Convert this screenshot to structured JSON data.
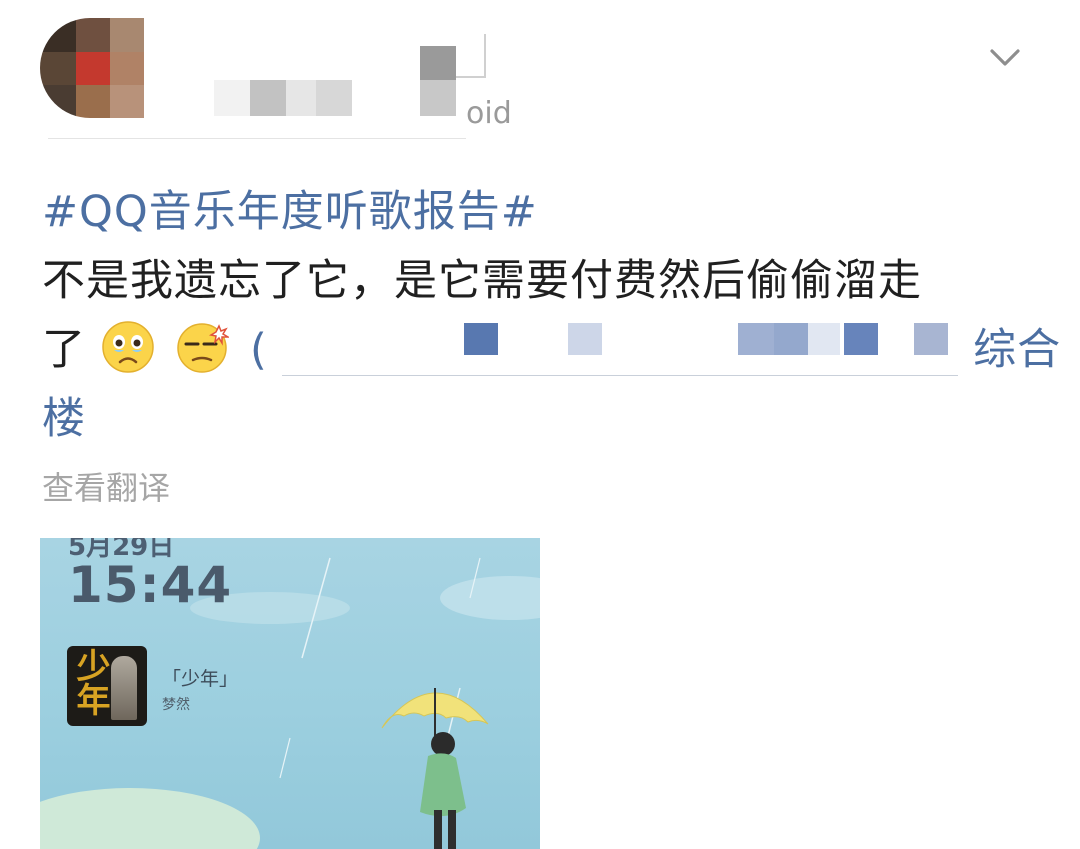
{
  "header": {
    "meta_suffix": "oid",
    "expand_icon": "chevron-down-icon"
  },
  "post": {
    "hashtag": "#QQ音乐年度听歌报告#",
    "text_line1": "不是我遗忘了它，是它需要付费然后偷偷溜走",
    "text_line2_start": "了",
    "emojis": [
      "crying-face-emoji",
      "annoyed-face-emoji"
    ],
    "mention_start": "(",
    "link_tail": "综合",
    "text_line3": "楼",
    "translate_label": "查看翻译"
  },
  "screenshot": {
    "date": "5月29日",
    "time": "15:44",
    "song_title": "「少年」",
    "artist": "梦然",
    "album_art_text": "少年"
  },
  "colors": {
    "hashtag": "#4c6fa2",
    "body_text": "#202020",
    "muted": "#a6a6a6",
    "sky": "#a8d4e3",
    "umbrella": "#f1e27a",
    "coat": "#7dbf8c"
  }
}
